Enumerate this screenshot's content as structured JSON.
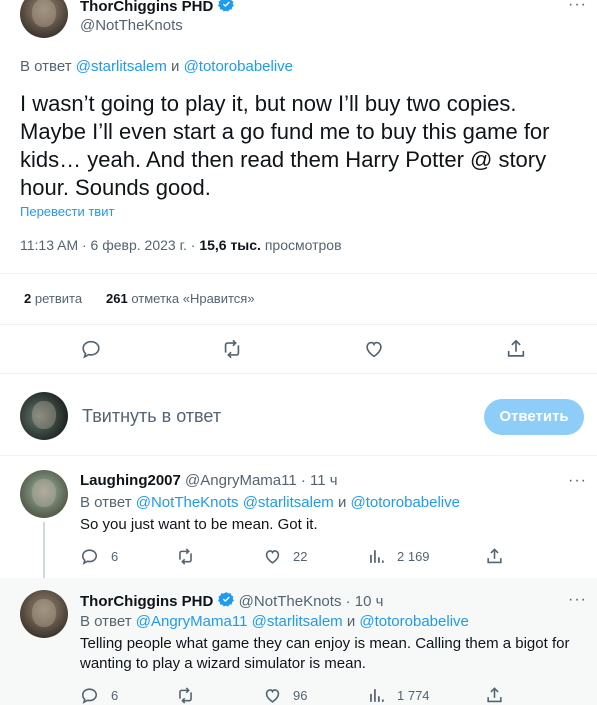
{
  "main_tweet": {
    "author_name": "ThorChiggins PHD",
    "author_handle": "@NotTheKnots",
    "reply_prefix": "В ответ",
    "reply_to_1": "@starlitsalem",
    "reply_and": "и",
    "reply_to_2": "@totorobabelive",
    "text": "I wasn’t going to play it, but now I’ll buy two copies. Maybe I’ll even start a go fund me to buy this game for kids… yeah. And then read them Harry Potter @ story hour. Sounds good.",
    "translate": "Перевести твит",
    "time": "11:13 AM · 6 февр. 2023 г. · ",
    "views_count": "15,6 тыс.",
    "views_label": " просмотров",
    "retweets_count": "2",
    "retweets_label": "ретвита",
    "likes_count": "261",
    "likes_label": "отметка «Нравится»"
  },
  "compose": {
    "placeholder": "Твитнуть в ответ",
    "button": "Ответить"
  },
  "replies": [
    {
      "author_name": "Laughing2007",
      "author_handle": "@AngryMama11",
      "sep": "·",
      "time": "11 ч",
      "reply_prefix": "В ответ",
      "reply_to_1": "@NotTheKnots",
      "reply_to_2": "@starlitsalem",
      "reply_and": "и",
      "reply_to_3": "@totorobabelive",
      "text": "So you just want to be mean. Got it.",
      "replies_count": "6",
      "retweets_count": "",
      "likes_count": "22",
      "views_count": "2 169"
    },
    {
      "author_name": "ThorChiggins PHD",
      "author_handle": "@NotTheKnots",
      "sep": "·",
      "time": "10 ч",
      "reply_prefix": "В ответ",
      "reply_to_1": "@AngryMama11",
      "reply_to_2": "@starlitsalem",
      "reply_and": "и",
      "reply_to_3": "@totorobabelive",
      "text": "Telling people what game they can enjoy is mean. Calling them a bigot for wanting to play a wizard simulator is mean.",
      "replies_count": "6",
      "retweets_count": "",
      "likes_count": "96",
      "views_count": "1 774"
    }
  ],
  "colors": {
    "accent": "#1d9bf0",
    "muted": "#536471",
    "reply_button_disabled": "#8ecdf8"
  }
}
